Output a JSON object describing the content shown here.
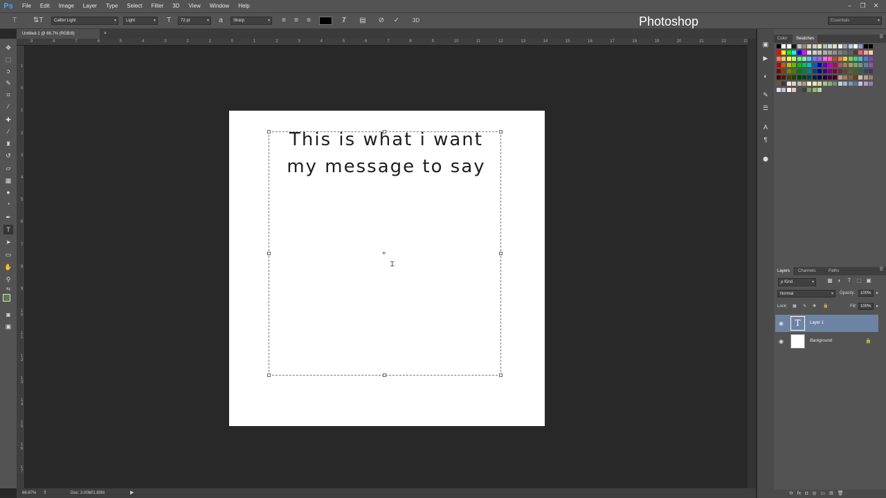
{
  "app": {
    "logo": "Ps",
    "brand": "Photoshop"
  },
  "menu": [
    "File",
    "Edit",
    "Image",
    "Layer",
    "Type",
    "Select",
    "Filter",
    "3D",
    "View",
    "Window",
    "Help"
  ],
  "window_controls": {
    "minimize": "‒",
    "restore": "❐",
    "close": "✕"
  },
  "options": {
    "tool_icon": "T",
    "orient_icon": "⇅T",
    "font_family": "Calibri Light",
    "font_style": "Light",
    "size_icon": "T",
    "font_size": "72 pt",
    "aa_icon": "a",
    "antialias": "Sharp",
    "text_color": "#000000",
    "workspace": "Essentials",
    "commit_3d": "3D"
  },
  "document": {
    "tab_title": "Untitled-1 @ 66.7% (RGB/8)",
    "tab_close": "×",
    "text_line1": "This is what i want",
    "text_line2": "my message to say"
  },
  "ruler": {
    "top": [
      "9",
      "8",
      "7",
      "6",
      "5",
      "4",
      "3",
      "2",
      "1",
      "0",
      "1",
      "2",
      "3",
      "4",
      "5",
      "6",
      "7",
      "8",
      "9",
      "10",
      "11",
      "12",
      "13",
      "14",
      "15",
      "16",
      "17",
      "18",
      "19",
      "20",
      "21",
      "22",
      "23"
    ],
    "left": [
      "1",
      "0",
      "1",
      "2",
      "3",
      "4",
      "5",
      "6",
      "7",
      "8",
      "9",
      "1\n0",
      "1\n1",
      "1\n2",
      "1\n3",
      "1\n4",
      "1\n5",
      "1\n6",
      "1\n7"
    ]
  },
  "status": {
    "zoom": "66.67%",
    "doc": "Doc: 3.00M/1.80M",
    "arrow": "▶"
  },
  "panels": {
    "top_tabs": [
      "Color",
      "Swatches"
    ],
    "layer_tabs": [
      "Layers",
      "Channels",
      "Paths"
    ],
    "kind": "ρ Kind",
    "blend_mode": "Normal",
    "opacity_label": "Opacity:",
    "opacity_value": "100%",
    "lock_label": "Lock:",
    "fill_label": "Fill:",
    "fill_value": "100%",
    "layers": [
      {
        "name": "Layer 1",
        "thumb": "T",
        "selected": true
      },
      {
        "name": "Background",
        "thumb": "",
        "selected": false,
        "locked": true
      }
    ],
    "footer_icons": "⊖  fx  ◘  ◎  ▭  ⊞  🗑"
  },
  "colors": {
    "foreground": "#5b7a4b",
    "background": "#ffffff",
    "selected_layer": "#6d83a3",
    "swatches": [
      [
        "#000000",
        "#ffffff",
        "#ffffff",
        "#1a1a1a",
        "#c0c0c0",
        "#8c8c8c",
        "#d8d0b0",
        "#d0d0c0",
        "#e8e0c8",
        "#b0c8a8",
        "#c8d8e0",
        "#e0e0c0",
        "#f0f0f0",
        "#a0a0a0",
        "#b8d0e8",
        "#ffffff",
        "#9098d0",
        "#000000",
        "#000000"
      ],
      [
        "#ff0000",
        "#ffff00",
        "#00ff00",
        "#00ffff",
        "#0000ff",
        "#ff00ff",
        "#e0e0e0",
        "#d0d0d0",
        "#c0c0c0",
        "#b0b0b0",
        "#a0a0a0",
        "#909090",
        "#808080",
        "#707070",
        "#606060",
        "#404040",
        "#ff6060",
        "#ffa0a0",
        "#ffd0a0"
      ],
      [
        "#ff7f50",
        "#ffc060",
        "#fff060",
        "#c0ff60",
        "#60ff60",
        "#60ffc0",
        "#60c0ff",
        "#6080ff",
        "#a060ff",
        "#ff60ff",
        "#ff60a0",
        "#d04040",
        "#e08040",
        "#e0d040",
        "#80d040",
        "#40d080",
        "#40c0d0",
        "#4080d0",
        "#8040d0"
      ],
      [
        "#c00000",
        "#c06000",
        "#c0c000",
        "#60c000",
        "#00c000",
        "#00c060",
        "#00c0c0",
        "#0060c0",
        "#0000c0",
        "#6000c0",
        "#c000c0",
        "#c00060",
        "#a06060",
        "#a08060",
        "#a0a060",
        "#80a060",
        "#60a080",
        "#6080a0",
        "#8060a0"
      ],
      [
        "#800000",
        "#804000",
        "#808000",
        "#408000",
        "#008000",
        "#008040",
        "#008080",
        "#004080",
        "#000080",
        "#400080",
        "#800080",
        "#800040",
        "#603030",
        "#604830",
        "#606030",
        "#486030",
        "#306048",
        "#304860",
        "#483060"
      ],
      [
        "#400000",
        "#402000",
        "#404000",
        "#204000",
        "#004000",
        "#004020",
        "#004040",
        "#002040",
        "#000040",
        "#200040",
        "#400040",
        "#400020",
        "#c0a080",
        "#a08060",
        "#806040",
        "#604020",
        "#d0c0b0",
        "#b0a090",
        "#908070"
      ],
      [
        "#705040",
        "#503020",
        "#f0e8e0",
        "#e0d0c0",
        "#c8b8a0",
        "#a89880",
        "#f0f0d0",
        "#e8e8b0",
        "#d0d8a0",
        "#b0c090",
        "#90a880",
        "#709070",
        "#c0d0e0",
        "#a0b8d0",
        "#8098b8",
        "#607898",
        "#d0c0e0",
        "#b0a0c8",
        "#9080b0"
      ],
      [
        "#e0e0ff",
        "#c0c0e0",
        "#ffffff",
        "#f0c0c0",
        "#505050",
        "#404040",
        "#7a9a5a",
        "#9ab87a",
        "#bad09a"
      ]
    ]
  }
}
